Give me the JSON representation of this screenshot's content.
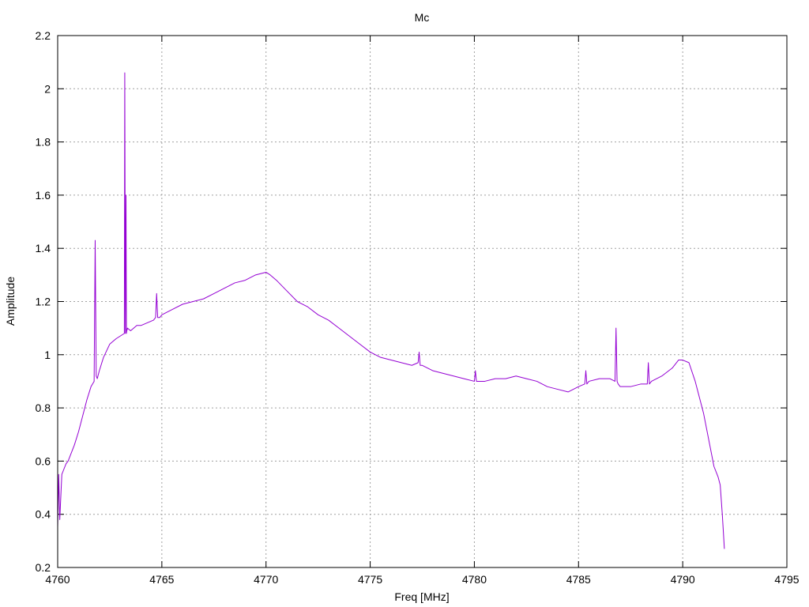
{
  "chart_data": {
    "type": "line",
    "title": "Mc",
    "xlabel": "Freq [MHz]",
    "ylabel": "Amplitude",
    "xlim": [
      4760,
      4795
    ],
    "ylim": [
      0.2,
      2.2
    ],
    "grid": true,
    "x_ticks": [
      "4760",
      "4765",
      "4770",
      "4775",
      "4780",
      "4785",
      "4790",
      "4795"
    ],
    "y_ticks": [
      "0.2",
      "0.4",
      "0.6",
      "0.8",
      "1",
      "1.2",
      "1.4",
      "1.6",
      "1.8",
      "2",
      "2.2"
    ],
    "colors": {
      "series": "#9400d3",
      "grid": "#a0a0a0",
      "axis": "#000000"
    },
    "series": [
      {
        "x": [
          4760.0,
          4760.05,
          4760.1,
          4760.2,
          4760.3,
          4760.4,
          4760.5,
          4760.6,
          4760.8,
          4761.0,
          4761.2,
          4761.4,
          4761.6,
          4761.75,
          4761.8,
          4761.85,
          4761.9,
          4762.0,
          4762.2,
          4762.5,
          4762.8,
          4763.0,
          4763.2,
          4763.22,
          4763.25,
          4763.28,
          4763.3,
          4763.32,
          4763.35,
          4763.5,
          4763.8,
          4764.0,
          4764.3,
          4764.6,
          4764.7,
          4764.75,
          4764.8,
          4764.9,
          4765.0,
          4765.5,
          4766.0,
          4766.5,
          4767.0,
          4767.5,
          4768.0,
          4768.5,
          4769.0,
          4769.5,
          4770.0,
          4770.2,
          4770.5,
          4771.0,
          4771.5,
          4772.0,
          4772.5,
          4773.0,
          4773.5,
          4774.0,
          4774.5,
          4775.0,
          4775.5,
          4776.0,
          4776.5,
          4777.0,
          4777.3,
          4777.35,
          4777.4,
          4777.5,
          4778.0,
          4778.5,
          4779.0,
          4779.5,
          4780.0,
          4780.05,
          4780.1,
          4780.5,
          4781.0,
          4781.5,
          4782.0,
          4782.5,
          4783.0,
          4783.5,
          4784.0,
          4784.5,
          4785.0,
          4785.3,
          4785.35,
          4785.4,
          4785.5,
          4786.0,
          4786.5,
          4786.75,
          4786.8,
          4786.85,
          4786.9,
          4787.0,
          4787.5,
          4788.0,
          4788.3,
          4788.35,
          4788.4,
          4788.5,
          4789.0,
          4789.5,
          4789.8,
          4790.0,
          4790.3,
          4790.6,
          4791.0,
          4791.3,
          4791.5,
          4791.7,
          4791.8,
          4791.9,
          4792.0
        ],
        "y": [
          0.35,
          0.55,
          0.38,
          0.55,
          0.57,
          0.59,
          0.6,
          0.62,
          0.66,
          0.71,
          0.77,
          0.83,
          0.88,
          0.9,
          1.43,
          0.92,
          0.91,
          0.94,
          0.99,
          1.04,
          1.06,
          1.07,
          1.08,
          2.06,
          1.08,
          1.6,
          1.08,
          1.09,
          1.1,
          1.09,
          1.11,
          1.11,
          1.12,
          1.13,
          1.14,
          1.23,
          1.14,
          1.14,
          1.15,
          1.17,
          1.19,
          1.2,
          1.21,
          1.23,
          1.25,
          1.27,
          1.28,
          1.3,
          1.31,
          1.3,
          1.28,
          1.24,
          1.2,
          1.18,
          1.15,
          1.13,
          1.1,
          1.07,
          1.04,
          1.01,
          0.99,
          0.98,
          0.97,
          0.96,
          0.97,
          1.01,
          0.96,
          0.96,
          0.94,
          0.93,
          0.92,
          0.91,
          0.9,
          0.94,
          0.9,
          0.9,
          0.91,
          0.91,
          0.92,
          0.91,
          0.9,
          0.88,
          0.87,
          0.86,
          0.88,
          0.89,
          0.94,
          0.89,
          0.9,
          0.91,
          0.91,
          0.9,
          1.1,
          0.9,
          0.89,
          0.88,
          0.88,
          0.89,
          0.89,
          0.97,
          0.89,
          0.9,
          0.92,
          0.95,
          0.98,
          0.98,
          0.97,
          0.9,
          0.78,
          0.66,
          0.58,
          0.54,
          0.51,
          0.4,
          0.27
        ]
      }
    ]
  }
}
